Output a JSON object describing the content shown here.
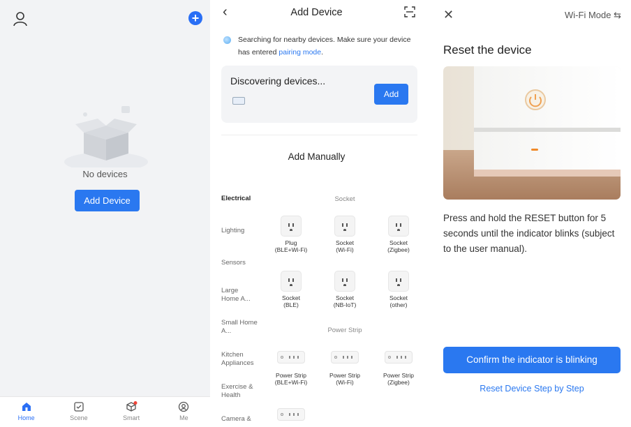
{
  "home": {
    "empty_text": "No devices",
    "add_button": "Add Device",
    "tabs": [
      {
        "label": "Home",
        "icon": "home-icon"
      },
      {
        "label": "Scene",
        "icon": "scene-icon"
      },
      {
        "label": "Smart",
        "icon": "smart-icon"
      },
      {
        "label": "Me",
        "icon": "me-icon"
      }
    ]
  },
  "add_device": {
    "title": "Add Device",
    "search_text": "Searching for nearby devices. Make sure your device has entered",
    "search_link": "pairing mode",
    "search_end": ".",
    "discover_title": "Discovering devices...",
    "discover_button": "Add",
    "manual_title": "Add Manually",
    "categories": [
      "Electrical",
      "Lighting",
      "Sensors",
      "Large Home A...",
      "Small Home A...",
      "Kitchen Appliances",
      "Exercise & Health",
      "Camera &"
    ],
    "section_socket": "Socket",
    "section_strip": "Power Strip",
    "sockets": [
      {
        "line1": "Plug",
        "line2": "(BLE+Wi-Fi)"
      },
      {
        "line1": "Socket",
        "line2": "(Wi-Fi)"
      },
      {
        "line1": "Socket",
        "line2": "(Zigbee)"
      },
      {
        "line1": "Socket",
        "line2": "(BLE)"
      },
      {
        "line1": "Socket",
        "line2": "(NB-IoT)"
      },
      {
        "line1": "Socket",
        "line2": "(other)"
      }
    ],
    "strips": [
      {
        "line1": "Power Strip",
        "line2": "(BLE+Wi-Fi)"
      },
      {
        "line1": "Power Strip",
        "line2": "(Wi-Fi)"
      },
      {
        "line1": "Power Strip",
        "line2": "(Zigbee)"
      }
    ]
  },
  "reset": {
    "mode": "Wi-Fi Mode",
    "title": "Reset the device",
    "description": "Press and hold the RESET button for 5 seconds until the indicator blinks (subject to the user manual).",
    "confirm_button": "Confirm the indicator is blinking",
    "step_link": "Reset Device Step by Step"
  },
  "colors": {
    "accent": "#2a78f0",
    "badge": "#f04438"
  }
}
